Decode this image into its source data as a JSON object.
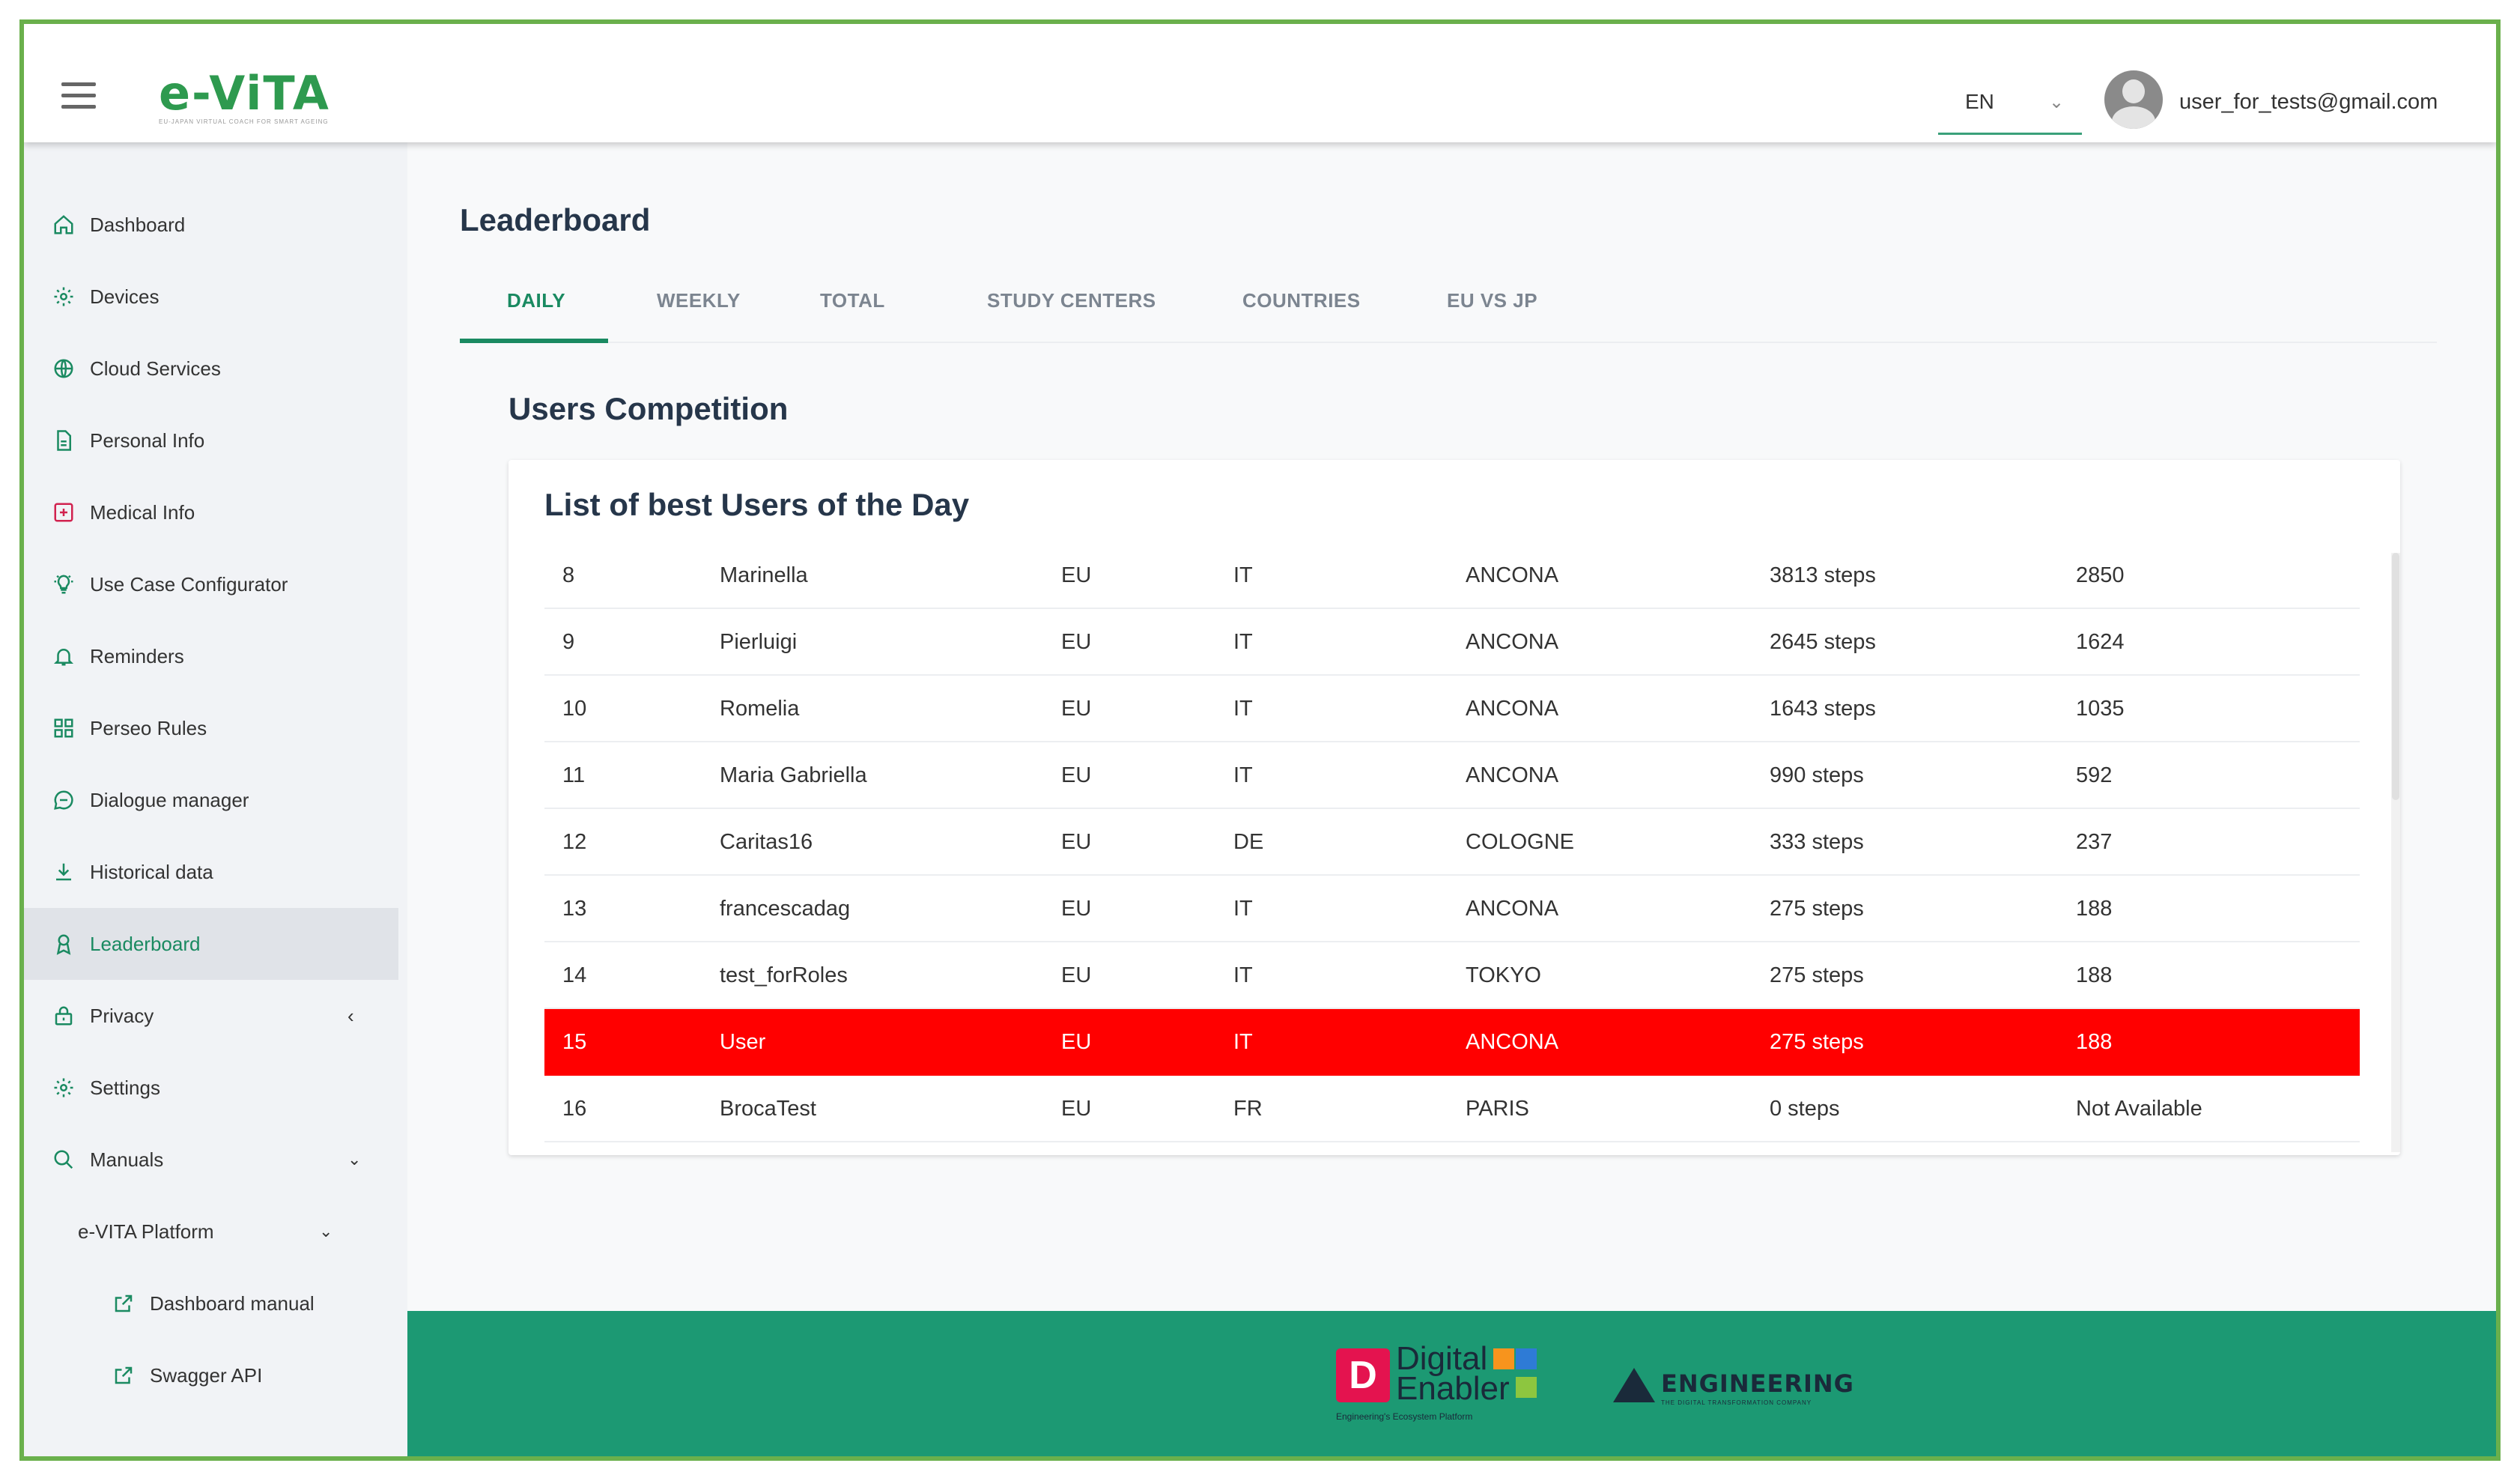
{
  "header": {
    "logo": "e-ViTA",
    "logo_sub": "EU-JAPAN VIRTUAL COACH FOR SMART AGEING",
    "language": "EN",
    "user_email": "user_for_tests@gmail.com"
  },
  "sidebar": {
    "items": [
      {
        "label": "Dashboard",
        "icon": "home-icon"
      },
      {
        "label": "Devices",
        "icon": "gear-icon"
      },
      {
        "label": "Cloud Services",
        "icon": "globe-icon"
      },
      {
        "label": "Personal Info",
        "icon": "document-icon"
      },
      {
        "label": "Medical Info",
        "icon": "medical-box-icon"
      },
      {
        "label": "Use Case Configurator",
        "icon": "lightbulb-icon"
      },
      {
        "label": "Reminders",
        "icon": "bell-icon"
      },
      {
        "label": "Perseo Rules",
        "icon": "grid-icon"
      },
      {
        "label": "Dialogue manager",
        "icon": "chat-icon"
      },
      {
        "label": "Historical data",
        "icon": "download-icon"
      },
      {
        "label": "Leaderboard",
        "icon": "award-icon",
        "active": true
      },
      {
        "label": "Privacy",
        "icon": "lock-icon"
      },
      {
        "label": "Settings",
        "icon": "gear-icon"
      },
      {
        "label": "Manuals",
        "icon": "search-icon"
      }
    ],
    "platform_label": "e-VITA Platform",
    "sub_items": [
      {
        "label": "Dashboard manual",
        "icon": "external-link-icon"
      },
      {
        "label": "Swagger API",
        "icon": "external-link-icon"
      }
    ]
  },
  "main": {
    "page_title": "Leaderboard",
    "tabs": [
      "DAILY",
      "WEEKLY",
      "TOTAL",
      "STUDY CENTERS",
      "COUNTRIES",
      "EU VS JP"
    ],
    "active_tab": "DAILY",
    "section_title": "Users Competition",
    "card_title": "List of best Users of the Day",
    "rows": [
      [
        "8",
        "Marinella",
        "EU",
        "IT",
        "ANCONA",
        "3813 steps",
        "2850"
      ],
      [
        "9",
        "Pierluigi",
        "EU",
        "IT",
        "ANCONA",
        "2645 steps",
        "1624"
      ],
      [
        "10",
        "Romelia",
        "EU",
        "IT",
        "ANCONA",
        "1643 steps",
        "1035"
      ],
      [
        "11",
        "Maria Gabriella",
        "EU",
        "IT",
        "ANCONA",
        "990 steps",
        "592"
      ],
      [
        "12",
        "Caritas16",
        "EU",
        "DE",
        "COLOGNE",
        "333 steps",
        "237"
      ],
      [
        "13",
        "francescadag",
        "EU",
        "IT",
        "ANCONA",
        "275 steps",
        "188"
      ],
      [
        "14",
        "test_forRoles",
        "EU",
        "IT",
        "TOKYO",
        "275 steps",
        "188"
      ],
      [
        "15",
        "User",
        "EU",
        "IT",
        "ANCONA",
        "275 steps",
        "188"
      ],
      [
        "16",
        "BrocaTest",
        "EU",
        "FR",
        "PARIS",
        "0 steps",
        "Not Available"
      ]
    ],
    "highlight_row_index": 7,
    "highlight_color": "#ff0000"
  },
  "footer": {
    "digital_enabler_line1": "Digital",
    "digital_enabler_line2": "Enabler",
    "digital_enabler_sub": "Engineering's Ecosystem Platform",
    "engineering": "ENGINEERING",
    "engineering_sub": "THE DIGITAL TRANSFORMATION COMPANY"
  },
  "colors": {
    "accent": "#1a8a61",
    "footer": "#1c9973",
    "frame_border": "#6ab04c"
  }
}
